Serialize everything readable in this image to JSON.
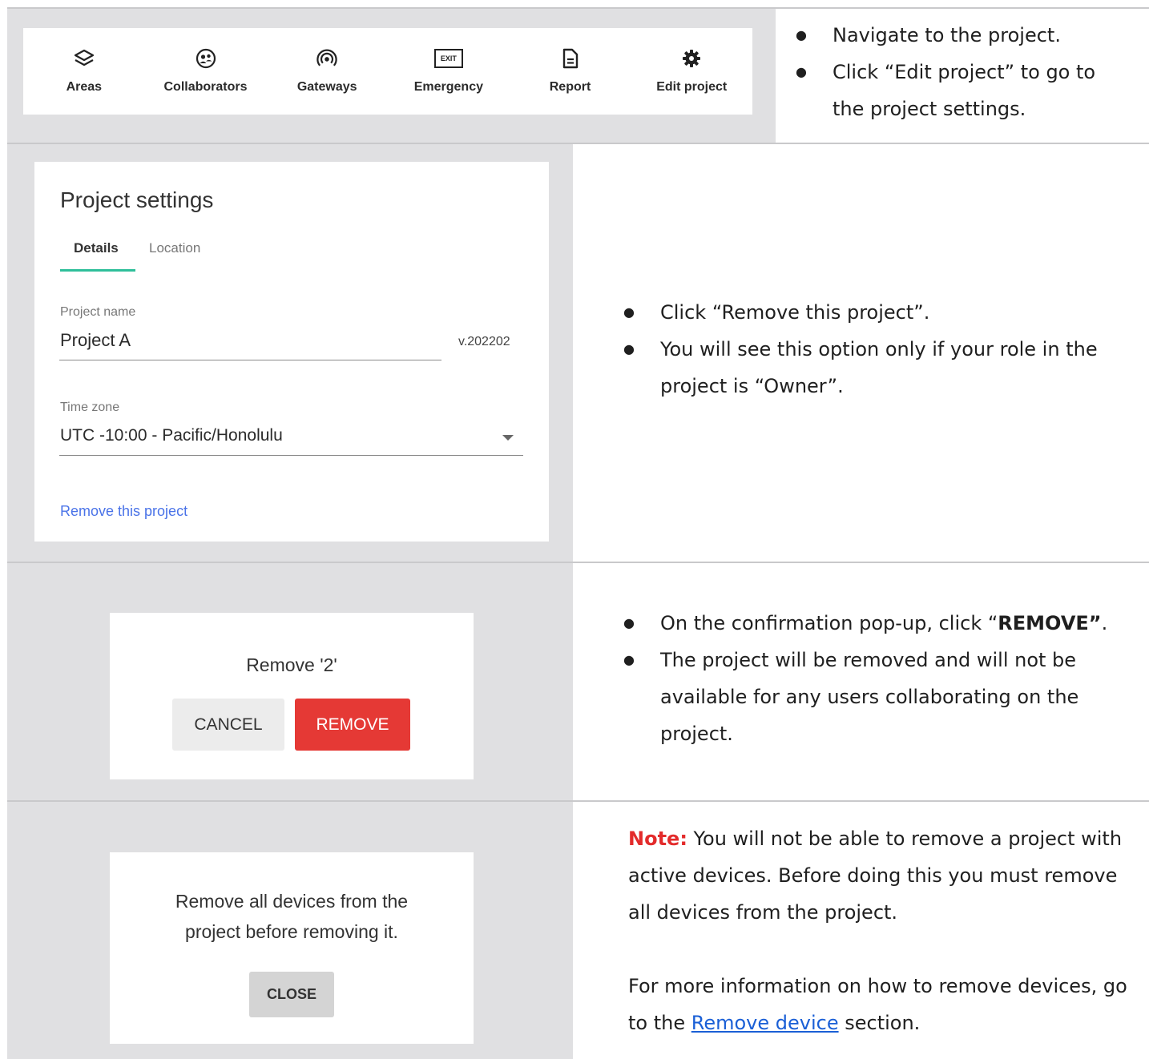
{
  "row1": {
    "toolbar": [
      {
        "label": "Areas",
        "icon": "layers-icon"
      },
      {
        "label": "Collaborators",
        "icon": "collaborators-icon"
      },
      {
        "label": "Gateways",
        "icon": "gateway-icon"
      },
      {
        "label": "Emergency",
        "icon": "exit-sign-icon",
        "icon_text": "EXIT"
      },
      {
        "label": "Report",
        "icon": "document-icon"
      },
      {
        "label": "Edit project",
        "icon": "gear-icon"
      }
    ],
    "steps": [
      "Navigate to the project.",
      "Click “Edit project” to go to the project settings."
    ]
  },
  "row2": {
    "settings": {
      "title": "Project settings",
      "tabs": [
        {
          "label": "Details",
          "active": true
        },
        {
          "label": "Location",
          "active": false
        }
      ],
      "project_name_label": "Project name",
      "project_name_value": "Project A",
      "version": "v.202202",
      "time_zone_label": "Time zone",
      "time_zone_value": "UTC -10:00 - Pacific/Honolulu",
      "remove_link": "Remove this project"
    },
    "steps": [
      "Click “Remove this project”.",
      "You will see this option only if your role in the project is “Owner”."
    ]
  },
  "row3": {
    "dialog": {
      "title": "Remove '2'",
      "cancel": "CANCEL",
      "remove": "REMOVE"
    },
    "steps": {
      "s1_prefix": "On the confirmation pop-up, click “",
      "s1_bold": "REMOVE”",
      "s1_suffix": ".",
      "s2": "The project will be removed and will not be available for any users collaborating on the project."
    }
  },
  "row4": {
    "dialog": {
      "message": "Remove all devices from the project before removing it.",
      "close": "CLOSE"
    },
    "note": {
      "label": "Note:",
      "text": " You will not be able to remove a project with active devices. Before doing this you must remove all devices from the project.",
      "more_prefix": "For more information on how to remove devices, go to the ",
      "more_link": "Remove device",
      "more_suffix": " section."
    }
  },
  "colors": {
    "panel_gray": "#e0e0e2",
    "tab_underline": "#2fbf9a",
    "link_blue": "#4a73e8",
    "remove_red": "#e53935",
    "note_red": "#e32b2b"
  }
}
